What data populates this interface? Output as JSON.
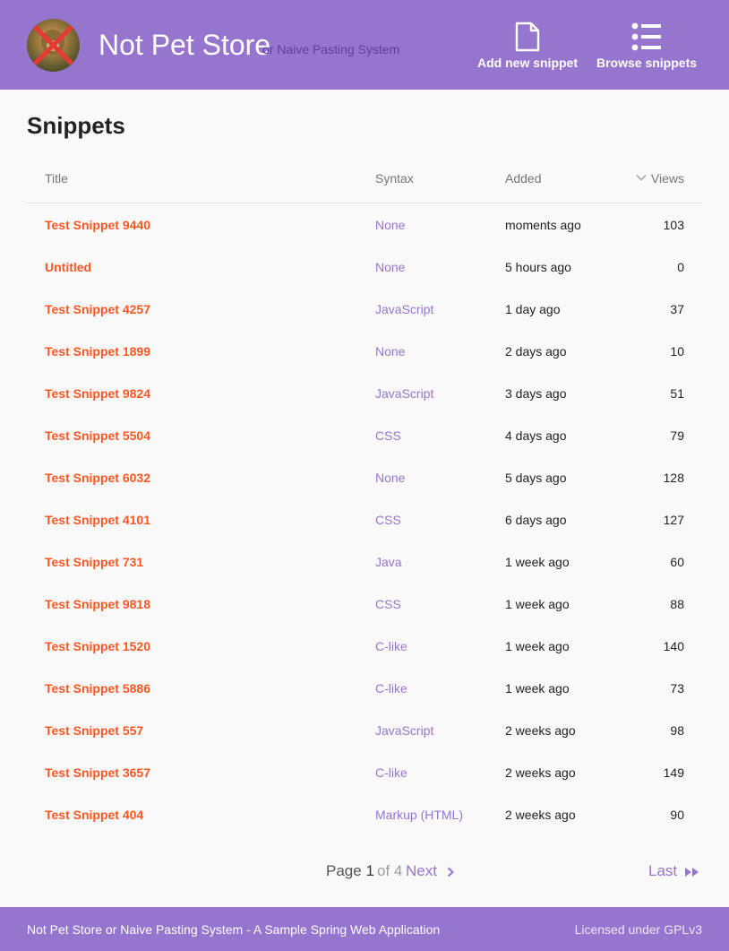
{
  "header": {
    "title": "Not Pet Store",
    "subtitle": "or Naive Pasting System",
    "add_label": "Add new snippet",
    "browse_label": "Browse snippets"
  },
  "main": {
    "heading": "Snippets",
    "columns": {
      "title": "Title",
      "syntax": "Syntax",
      "added": "Added",
      "views": "Views"
    },
    "sort": {
      "column": "Added",
      "direction": "descending"
    },
    "rows": [
      {
        "title": "Test Snippet 9440",
        "syntax": "None",
        "added": "moments ago",
        "views": "103"
      },
      {
        "title": "Untitled",
        "syntax": "None",
        "added": "5 hours ago",
        "views": "0"
      },
      {
        "title": "Test Snippet 4257",
        "syntax": "JavaScript",
        "added": "1 day ago",
        "views": "37"
      },
      {
        "title": "Test Snippet 1899",
        "syntax": "None",
        "added": "2 days ago",
        "views": "10"
      },
      {
        "title": "Test Snippet 9824",
        "syntax": "JavaScript",
        "added": "3 days ago",
        "views": "51"
      },
      {
        "title": "Test Snippet 5504",
        "syntax": "CSS",
        "added": "4 days ago",
        "views": "79"
      },
      {
        "title": "Test Snippet 6032",
        "syntax": "None",
        "added": "5 days ago",
        "views": "128"
      },
      {
        "title": "Test Snippet 4101",
        "syntax": "CSS",
        "added": "6 days ago",
        "views": "127"
      },
      {
        "title": "Test Snippet 731",
        "syntax": "Java",
        "added": "1 week ago",
        "views": "60"
      },
      {
        "title": "Test Snippet 9818",
        "syntax": "CSS",
        "added": "1 week ago",
        "views": "88"
      },
      {
        "title": "Test Snippet 1520",
        "syntax": "C-like",
        "added": "1 week ago",
        "views": "140"
      },
      {
        "title": "Test Snippet 5886",
        "syntax": "C-like",
        "added": "1 week ago",
        "views": "73"
      },
      {
        "title": "Test Snippet 557",
        "syntax": "JavaScript",
        "added": "2 weeks ago",
        "views": "98"
      },
      {
        "title": "Test Snippet 3657",
        "syntax": "C-like",
        "added": "2 weeks ago",
        "views": "149"
      },
      {
        "title": "Test Snippet 404",
        "syntax": "Markup (HTML)",
        "added": "2 weeks ago",
        "views": "90"
      }
    ]
  },
  "pagination": {
    "page_label": "Page",
    "current": "1",
    "of_label": "of",
    "total": "4",
    "next_label": "Next",
    "last_label": "Last"
  },
  "footer": {
    "left": "Not Pet Store or Naive Pasting System - A Sample Spring Web Application",
    "right": "Licensed under GPLv3"
  },
  "icons": {
    "logo": "crossed-out-pet-photo",
    "add": "document-icon",
    "browse": "list-icon",
    "sort": "chevron-down-icon",
    "next": "chevron-right-icon",
    "last": "fast-forward-icon"
  },
  "colors": {
    "primary": "#9575cd",
    "accent": "#ff5722",
    "subtitle": "#5e3f9f",
    "background": "#f9f9f9"
  }
}
